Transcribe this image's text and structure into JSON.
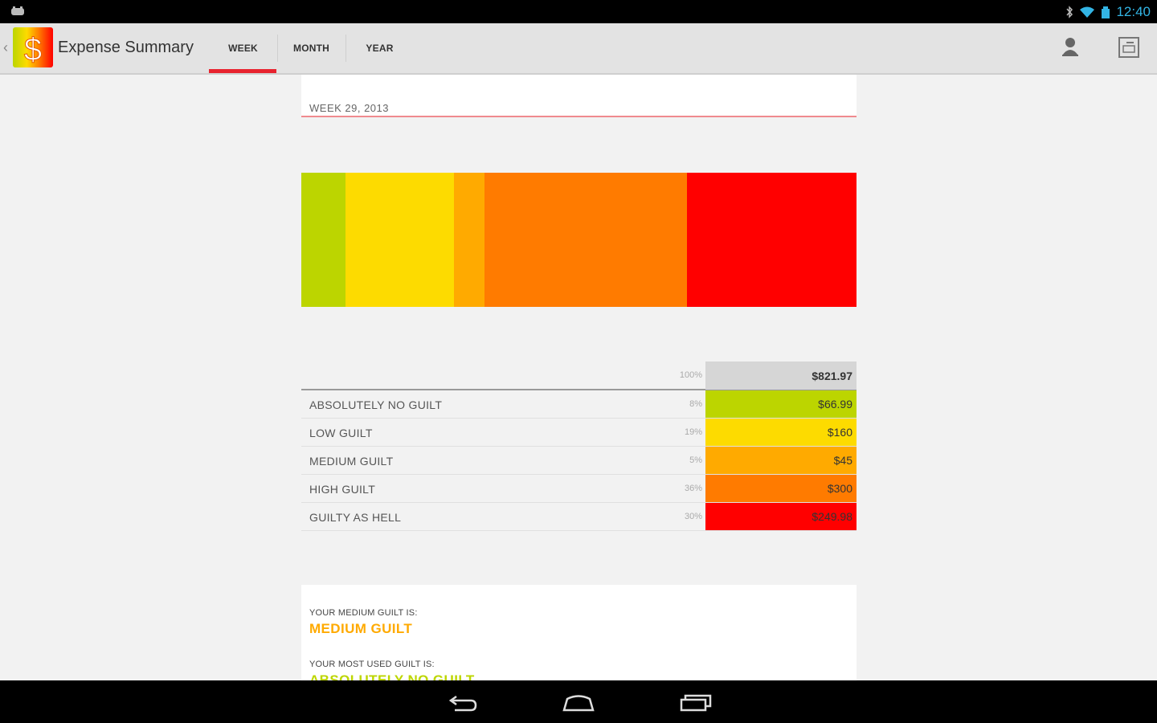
{
  "status_bar": {
    "time": "12:40",
    "icons": [
      "notification-icon",
      "bluetooth-icon",
      "wifi-icon",
      "signal-icon"
    ]
  },
  "action_bar": {
    "title": "Expense Summary",
    "tabs": [
      {
        "label": "WEEK",
        "active": true
      },
      {
        "label": "MONTH",
        "active": false
      },
      {
        "label": "YEAR",
        "active": false
      }
    ],
    "actions": [
      "person-icon",
      "edit-note-icon"
    ]
  },
  "week_label": "WEEK 29, 2013",
  "stacked_bar": {
    "segments": [
      {
        "name": "ABSOLUTELY NO GUILT",
        "fraction": 0.08,
        "color": "#bcd500"
      },
      {
        "name": "LOW GUILT",
        "fraction": 0.195,
        "color": "#fddb00"
      },
      {
        "name": "MEDIUM GUILT",
        "fraction": 0.055,
        "color": "#ffaa00"
      },
      {
        "name": "HIGH GUILT",
        "fraction": 0.365,
        "color": "#ff7b00"
      },
      {
        "name": "GUILTY AS HELL",
        "fraction": 0.305,
        "color": "#ff0000"
      }
    ]
  },
  "table": {
    "total": {
      "percent": "100%",
      "amount": "$821.97",
      "color": "#d6d6d6"
    },
    "rows": [
      {
        "label": "ABSOLUTELY NO GUILT",
        "percent": "8%",
        "amount": "$66.99",
        "color": "#bcd500"
      },
      {
        "label": "LOW GUILT",
        "percent": "19%",
        "amount": "$160",
        "color": "#fddb00"
      },
      {
        "label": "MEDIUM GUILT",
        "percent": "5%",
        "amount": "$45",
        "color": "#ffaa00"
      },
      {
        "label": "HIGH GUILT",
        "percent": "36%",
        "amount": "$300",
        "color": "#ff7b00"
      },
      {
        "label": "GUILTY AS HELL",
        "percent": "30%",
        "amount": "$249.98",
        "color": "#ff0000"
      }
    ]
  },
  "summary": {
    "median_label": "YOUR MEDIUM GUILT IS:",
    "median_value": "MEDIUM GUILT",
    "median_color": "#ffaa00",
    "most_used_label": "YOUR MOST USED GUILT IS:",
    "most_used_value": "ABSOLUTELY NO GUILT",
    "most_used_color": "#bcd500"
  },
  "nav_bar": {
    "buttons": [
      "back-icon",
      "home-icon",
      "recent-apps-icon"
    ]
  }
}
